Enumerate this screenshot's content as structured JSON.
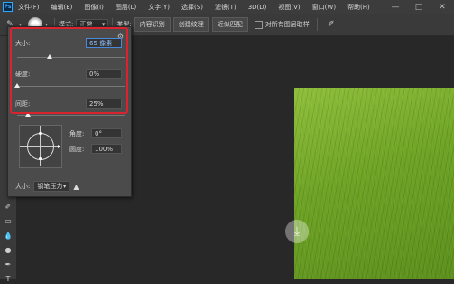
{
  "menubar": {
    "logo": "Ps",
    "items": [
      "文件(F)",
      "编辑(E)",
      "图像(I)",
      "图层(L)",
      "文字(Y)",
      "选择(S)",
      "滤镜(T)",
      "3D(D)",
      "视图(V)",
      "窗口(W)",
      "帮助(H)"
    ]
  },
  "window": {
    "minimize": "—",
    "restore": "□",
    "close": "✕"
  },
  "options": {
    "mode_label": "模式:",
    "mode_value": "正常",
    "type_label": "类型:",
    "btn_content_aware": "内容识别",
    "btn_create_texture": "创建纹理",
    "btn_proximity_match": "近似匹配",
    "sample_all_layers": "对所有图层取样"
  },
  "brush_popup": {
    "size_label": "大小:",
    "size_value": "65 像素",
    "size_slider_fraction": 0.3,
    "hardness_label": "硬度:",
    "hardness_value": "0%",
    "hardness_slider_fraction": 0.0,
    "spacing_label": "间距:",
    "spacing_value": "25%",
    "spacing_slider_fraction": 0.1,
    "angle_label": "角度:",
    "angle_value": "0°",
    "roundness_label": "圆度:",
    "roundness_value": "100%",
    "bottom_size_label": "大小:",
    "pen_pressure_value": "钢笔压力"
  },
  "colors": {
    "highlight": "#d9232e",
    "accent": "#4a8ad8"
  }
}
